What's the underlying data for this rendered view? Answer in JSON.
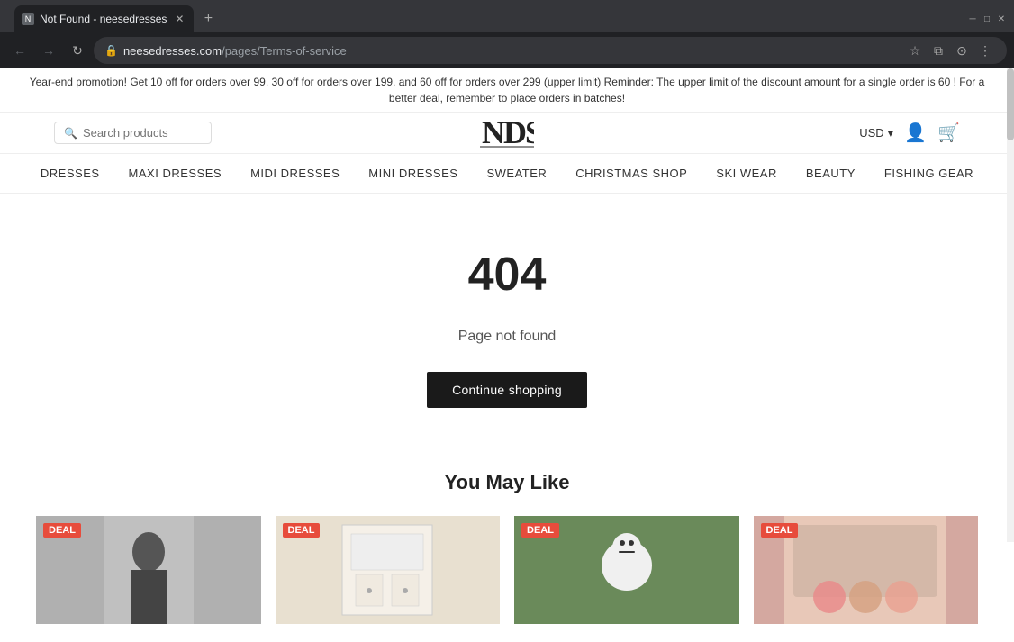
{
  "browser": {
    "tab_title": "Not Found - neesedresses",
    "favicon_text": "N",
    "url_domain": "neesedresses.com",
    "url_path": "/pages/Terms-of-service",
    "new_tab_label": "+",
    "back_btn": "←",
    "forward_btn": "→",
    "refresh_btn": "↻",
    "star_icon": "☆",
    "extensions_icon": "⧉",
    "account_icon": "⊙",
    "menu_icon": "⋮"
  },
  "promo": {
    "text": "Year-end promotion! Get 10 off for orders over 99, 30 off for orders over 199, and 60 off for orders over 299 (upper limit) Reminder: The upper limit of the discount amount for a single order is 60 ! For a better deal, remember to place orders in batches!"
  },
  "header": {
    "search_placeholder": "Search products",
    "currency": "USD",
    "currency_arrow": "▾"
  },
  "nav": {
    "items": [
      {
        "label": "DRESSES"
      },
      {
        "label": "MAXI DRESSES"
      },
      {
        "label": "MIDI DRESSES"
      },
      {
        "label": "MINI DRESSES"
      },
      {
        "label": "SWEATER"
      },
      {
        "label": "CHRISTMAS SHOP"
      },
      {
        "label": "SKI WEAR"
      },
      {
        "label": "BEAUTY"
      },
      {
        "label": "FISHING GEAR"
      }
    ]
  },
  "main": {
    "error_code": "404",
    "error_message": "Page not found",
    "continue_btn": "Continue shopping"
  },
  "you_may_like": {
    "title": "You May Like",
    "products": [
      {
        "badge": "DEAL",
        "alt": "Product 1"
      },
      {
        "badge": "DEAL",
        "alt": "Product 2"
      },
      {
        "badge": "DEAL",
        "alt": "Product 3"
      },
      {
        "badge": "DEAL",
        "alt": "Product 4"
      }
    ]
  }
}
